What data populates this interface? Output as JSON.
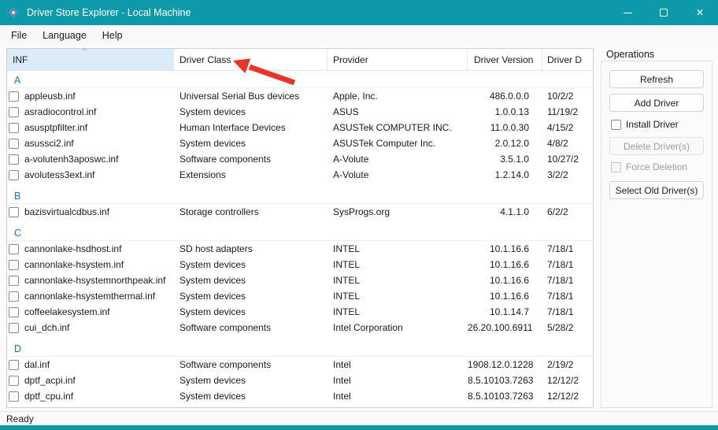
{
  "window": {
    "title": "Driver Store Explorer - Local Machine",
    "controls": {
      "close": "✕"
    }
  },
  "menu": {
    "items": [
      "File",
      "Language",
      "Help"
    ]
  },
  "table": {
    "sort_caret": "^",
    "columns": [
      "INF",
      "Driver Class",
      "Provider",
      "Driver Version",
      "Driver D"
    ],
    "groups": [
      {
        "letter": "A",
        "rows": [
          {
            "inf": "appleusb.inf",
            "driver_class": "Universal Serial Bus devices",
            "provider": "Apple, Inc.",
            "version": "486.0.0.0",
            "date": "10/2/2"
          },
          {
            "inf": "asradiocontrol.inf",
            "driver_class": "System devices",
            "provider": "ASUS",
            "version": "1.0.0.13",
            "date": "11/19/2"
          },
          {
            "inf": "asusptpfilter.inf",
            "driver_class": "Human Interface Devices",
            "provider": "ASUSTek COMPUTER INC.",
            "version": "11.0.0.30",
            "date": "4/15/2"
          },
          {
            "inf": "asussci2.inf",
            "driver_class": "System devices",
            "provider": "ASUSTek Computer Inc.",
            "version": "2.0.12.0",
            "date": "4/8/2"
          },
          {
            "inf": "a-volutenh3aposwc.inf",
            "driver_class": "Software components",
            "provider": "A-Volute",
            "version": "3.5.1.0",
            "date": "10/27/2"
          },
          {
            "inf": "avolutess3ext.inf",
            "driver_class": "Extensions",
            "provider": "A-Volute",
            "version": "1.2.14.0",
            "date": "3/2/2"
          }
        ]
      },
      {
        "letter": "B",
        "rows": [
          {
            "inf": "bazisvirtualcdbus.inf",
            "driver_class": "Storage controllers",
            "provider": "SysProgs.org",
            "version": "4.1.1.0",
            "date": "6/2/2"
          }
        ]
      },
      {
        "letter": "C",
        "rows": [
          {
            "inf": "cannonlake-hsdhost.inf",
            "driver_class": "SD host adapters",
            "provider": "INTEL",
            "version": "10.1.16.6",
            "date": "7/18/1"
          },
          {
            "inf": "cannonlake-hsystem.inf",
            "driver_class": "System devices",
            "provider": "INTEL",
            "version": "10.1.16.6",
            "date": "7/18/1"
          },
          {
            "inf": "cannonlake-hsystemnorthpeak.inf",
            "driver_class": "System devices",
            "provider": "INTEL",
            "version": "10.1.16.6",
            "date": "7/18/1"
          },
          {
            "inf": "cannonlake-hsystemthermal.inf",
            "driver_class": "System devices",
            "provider": "INTEL",
            "version": "10.1.16.6",
            "date": "7/18/1"
          },
          {
            "inf": "coffeelakesystem.inf",
            "driver_class": "System devices",
            "provider": "INTEL",
            "version": "10.1.14.7",
            "date": "7/18/1"
          },
          {
            "inf": "cui_dch.inf",
            "driver_class": "Software components",
            "provider": "Intel Corporation",
            "version": "26.20.100.6911",
            "date": "5/28/2"
          }
        ]
      },
      {
        "letter": "D",
        "rows": [
          {
            "inf": "dal.inf",
            "driver_class": "Software components",
            "provider": "Intel",
            "version": "1908.12.0.1228",
            "date": "2/19/2"
          },
          {
            "inf": "dptf_acpi.inf",
            "driver_class": "System devices",
            "provider": "Intel",
            "version": "8.5.10103.7263",
            "date": "12/12/2"
          },
          {
            "inf": "dptf_cpu.inf",
            "driver_class": "System devices",
            "provider": "Intel",
            "version": "8.5.10103.7263",
            "date": "12/12/2"
          }
        ]
      }
    ]
  },
  "operations": {
    "title": "Operations",
    "refresh": "Refresh",
    "add_driver": "Add Driver",
    "install_driver": "Install Driver",
    "delete_drivers": "Delete Driver(s)",
    "force_deletion": "Force Deletion",
    "select_old_drivers": "Select Old Driver(s)"
  },
  "status": {
    "text": "Ready"
  },
  "colors": {
    "accent": "#0d99a8",
    "sorted_column_bg": "#d9ecf8",
    "group_letter": "#2574a9",
    "arrow": "#e8352a"
  }
}
